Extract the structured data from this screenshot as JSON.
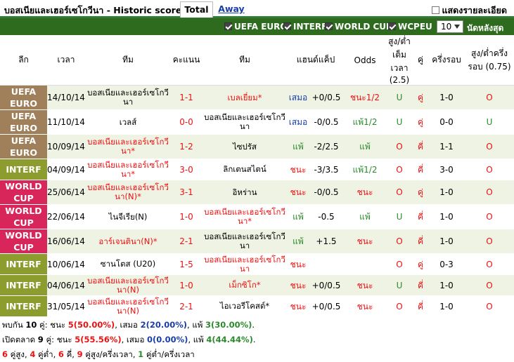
{
  "header": {
    "title": "บอสเนียและเฮอร์เซโกวีนา - Historic scores",
    "tabs": [
      {
        "label": "Total"
      },
      {
        "label": "Away"
      }
    ],
    "same_venue_label": "แสดงรายละเอียด"
  },
  "filters": {
    "items": [
      {
        "label": "UEFA EURO",
        "checked": true
      },
      {
        "label": "INTERF",
        "checked": true
      },
      {
        "label": "WORLD CUP",
        "checked": true
      },
      {
        "label": "WCPEU",
        "checked": true
      }
    ],
    "count_value": "10",
    "last_n_label": "นัดหลังสุด"
  },
  "columns": [
    "ลีก",
    "เวลา",
    "ทีม",
    "คะแนน",
    "ทีม",
    "แฮนด์แค็ป",
    "Odds",
    "สูง/ต่ำเต็มเวลา (2.5)",
    "คู่",
    "ครึ่งรอบ",
    "สูง/ต่ำครึ่งรอบ (0.75)"
  ],
  "league_colors": {
    "UEFA EURO": "#a0805a",
    "INTERF": "#8c9c2e",
    "WORLD CUP": "#d8265a"
  },
  "result_colors": {
    "win": "#e11",
    "draw": "#1a3ea8",
    "loss": "#2b8a2b"
  },
  "rows": [
    {
      "league": "UEFA EURO",
      "date": "14/10/14",
      "home": "บอสเนียและเฮอร์เซโกวีนา",
      "home_hl": false,
      "score": "1-1",
      "away": "เบลเยี่ยม*",
      "away_hl": true,
      "result": "เสมอ",
      "result_type": "draw",
      "handicap": "+0/0.5",
      "odds": "ชนะ1/2",
      "odds_type": "win",
      "ou": "U",
      "ou_type": "u",
      "oe": "คู่",
      "oe_type": "even",
      "ht": "1-0",
      "ht_ou": "O",
      "ht_ou_type": "o"
    },
    {
      "league": "UEFA EURO",
      "date": "11/10/14",
      "home": "เวลส์",
      "home_hl": false,
      "score": "0-0",
      "away": "บอสเนียและเฮอร์เซโกวีนา",
      "away_hl": false,
      "result": "เสมอ",
      "result_type": "draw",
      "handicap": "-0/0.5",
      "odds": "แพ้1/2",
      "odds_type": "loss",
      "ou": "U",
      "ou_type": "u",
      "oe": "คู่",
      "oe_type": "even",
      "ht": "0-0",
      "ht_ou": "U",
      "ht_ou_type": "u"
    },
    {
      "league": "UEFA EURO",
      "date": "10/09/14",
      "home": "บอสเนียและเฮอร์เซโกวีนา*",
      "home_hl": true,
      "score": "1-2",
      "away": "ไซปรัส",
      "away_hl": false,
      "result": "แพ้",
      "result_type": "loss",
      "handicap": "-2/2.5",
      "odds": "แพ้",
      "odds_type": "loss",
      "ou": "O",
      "ou_type": "o",
      "oe": "คี่",
      "oe_type": "odd",
      "ht": "1-1",
      "ht_ou": "O",
      "ht_ou_type": "o"
    },
    {
      "league": "INTERF",
      "date": "04/09/14",
      "home": "บอสเนียและเฮอร์เซโกวีนา*",
      "home_hl": true,
      "score": "3-0",
      "away": "ลิกเตนสไตน์",
      "away_hl": false,
      "result": "ชนะ",
      "result_type": "win",
      "handicap": "-3/3.5",
      "odds": "แพ้1/2",
      "odds_type": "loss",
      "ou": "O",
      "ou_type": "o",
      "oe": "คี่",
      "oe_type": "odd",
      "ht": "3-0",
      "ht_ou": "O",
      "ht_ou_type": "o"
    },
    {
      "league": "WORLD CUP",
      "date": "25/06/14",
      "home": "บอสเนียและเฮอร์เซโกวีนา(N)*",
      "home_hl": true,
      "score": "3-1",
      "away": "อิหร่าน",
      "away_hl": false,
      "result": "ชนะ",
      "result_type": "win",
      "handicap": "-0/0.5",
      "odds": "ชนะ",
      "odds_type": "win",
      "ou": "O",
      "ou_type": "o",
      "oe": "คู่",
      "oe_type": "even",
      "ht": "1-0",
      "ht_ou": "O",
      "ht_ou_type": "o"
    },
    {
      "league": "WORLD CUP",
      "date": "22/06/14",
      "home": "ไนจีเรีย(N)",
      "home_hl": false,
      "score": "1-0",
      "away": "บอสเนียและเฮอร์เซโกวีนา*",
      "away_hl": true,
      "result": "แพ้",
      "result_type": "loss",
      "handicap": "-0.5",
      "odds": "แพ้",
      "odds_type": "loss",
      "ou": "U",
      "ou_type": "u",
      "oe": "คี่",
      "oe_type": "odd",
      "ht": "1-0",
      "ht_ou": "O",
      "ht_ou_type": "o"
    },
    {
      "league": "WORLD CUP",
      "date": "16/06/14",
      "home": "อาร์เจนตินา(N)*",
      "home_hl": true,
      "score": "2-1",
      "away": "บอสเนียและเฮอร์เซโกวีนา",
      "away_hl": false,
      "result": "แพ้",
      "result_type": "loss",
      "handicap": "+1.5",
      "odds": "ชนะ",
      "odds_type": "win",
      "ou": "O",
      "ou_type": "o",
      "oe": "คี่",
      "oe_type": "odd",
      "ht": "1-0",
      "ht_ou": "O",
      "ht_ou_type": "o"
    },
    {
      "league": "INTERF",
      "date": "10/06/14",
      "home": "ซานโตส (U20)",
      "home_hl": false,
      "score": "1-5",
      "away": "บอสเนียและเฮอร์เซโกวีนา",
      "away_hl": true,
      "result": "ชนะ",
      "result_type": "win",
      "handicap": "",
      "odds": "",
      "odds_type": "win",
      "ou": "O",
      "ou_type": "o",
      "oe": "คู่",
      "oe_type": "even",
      "ht": "0-3",
      "ht_ou": "O",
      "ht_ou_type": "o"
    },
    {
      "league": "INTERF",
      "date": "04/06/14",
      "home": "บอสเนียและเฮอร์เซโกวีนา(N)",
      "home_hl": true,
      "score": "1-0",
      "away": "เม็กซิโก*",
      "away_hl": true,
      "result": "ชนะ",
      "result_type": "win",
      "handicap": "+0/0.5",
      "odds": "ชนะ",
      "odds_type": "win",
      "ou": "U",
      "ou_type": "u",
      "oe": "คี่",
      "oe_type": "odd",
      "ht": "1-0",
      "ht_ou": "O",
      "ht_ou_type": "o"
    },
    {
      "league": "INTERF",
      "date": "31/05/14",
      "home": "บอสเนียและเฮอร์เซโกวีนา(N)",
      "home_hl": true,
      "score": "2-1",
      "away": "ไอเวอรีโคสต์*",
      "away_hl": false,
      "result": "ชนะ",
      "result_type": "win",
      "handicap": "+0/0.5",
      "odds": "ชนะ",
      "odds_type": "win",
      "ou": "O",
      "ou_type": "o",
      "oe": "คี่",
      "oe_type": "odd",
      "ht": "1-0",
      "ht_ou": "O",
      "ht_ou_type": "o"
    }
  ],
  "summary": {
    "line1": {
      "p1": "พบกัน ",
      "n": "10",
      "p2": " คู่: ชนะ ",
      "win": "5(50.00%)",
      "p3": ", เสมอ ",
      "draw": "2(20.00%)",
      "p4": ", แพ้ ",
      "loss": "3(30.00%)",
      "p5": "."
    },
    "line2": {
      "p1": "เปิดตลาด ",
      "n": "9",
      "p2": " คู่: ชนะ ",
      "win": "5(55.56%)",
      "p3": ", เสมอ ",
      "draw": "0(0.00%)",
      "p4": ", แพ้ ",
      "loss": "4(44.44%)",
      "p5": "."
    },
    "line3": {
      "a": "6",
      "b": " คู่สูง, ",
      "c": "4",
      "d": " คู่ต่ำ, ",
      "e": "6",
      "f": " คี่, ",
      "g": "9",
      "h": " คู่สูง/ครึ่งเวลา, ",
      "i": "1",
      "j": " คู่ต่ำ/ครึ่งเวลา"
    }
  }
}
